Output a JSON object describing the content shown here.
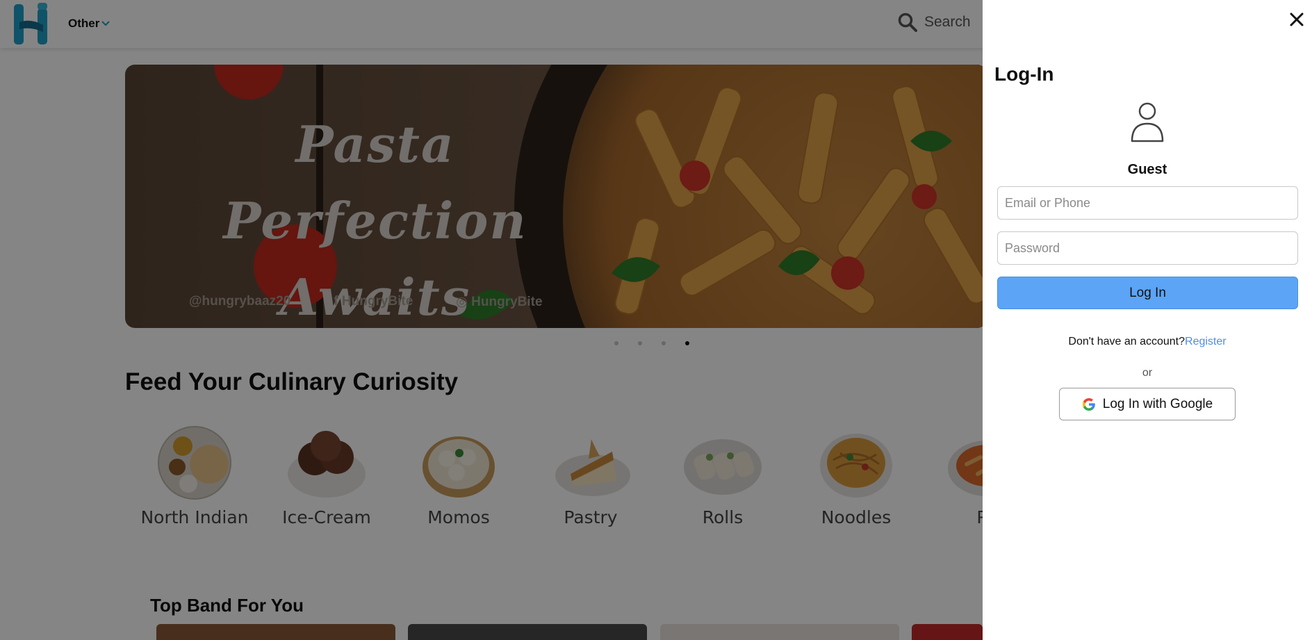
{
  "header": {
    "menu_label": "Other",
    "search_label": "Search"
  },
  "banner": {
    "title_line1": "Pasta Perfection",
    "title_line2": "Awaits",
    "social": [
      "@hungrybaaz20",
      "f HungryBite",
      "◎ HungryBite"
    ],
    "slide_count": 4,
    "active_slide": 4
  },
  "main": {
    "section_title": "Feed Your Culinary Curiosity",
    "categories": [
      {
        "label": "North Indian",
        "icon": "thali-icon"
      },
      {
        "label": "Ice-Cream",
        "icon": "ice-cream-icon"
      },
      {
        "label": "Momos",
        "icon": "momos-icon"
      },
      {
        "label": "Pastry",
        "icon": "pastry-icon"
      },
      {
        "label": "Rolls",
        "icon": "rolls-icon"
      },
      {
        "label": "Noodles",
        "icon": "noodles-icon"
      },
      {
        "label": "Pa",
        "icon": "pasta-icon"
      }
    ],
    "band_title": "Top Band For You"
  },
  "login": {
    "title": "Log-In",
    "user_label": "Guest",
    "email_placeholder": "Email or Phone",
    "password_placeholder": "Password",
    "login_button": "Log In",
    "no_account_text": "Don't have an account?",
    "register_link": "Register",
    "or_text": "or",
    "google_button": "Log In with Google"
  },
  "colors": {
    "accent": "#5ba4f6",
    "link": "#4a8fe0",
    "logo": "#1ea0c7",
    "overlay": "rgba(0,0,0,0.48)"
  }
}
